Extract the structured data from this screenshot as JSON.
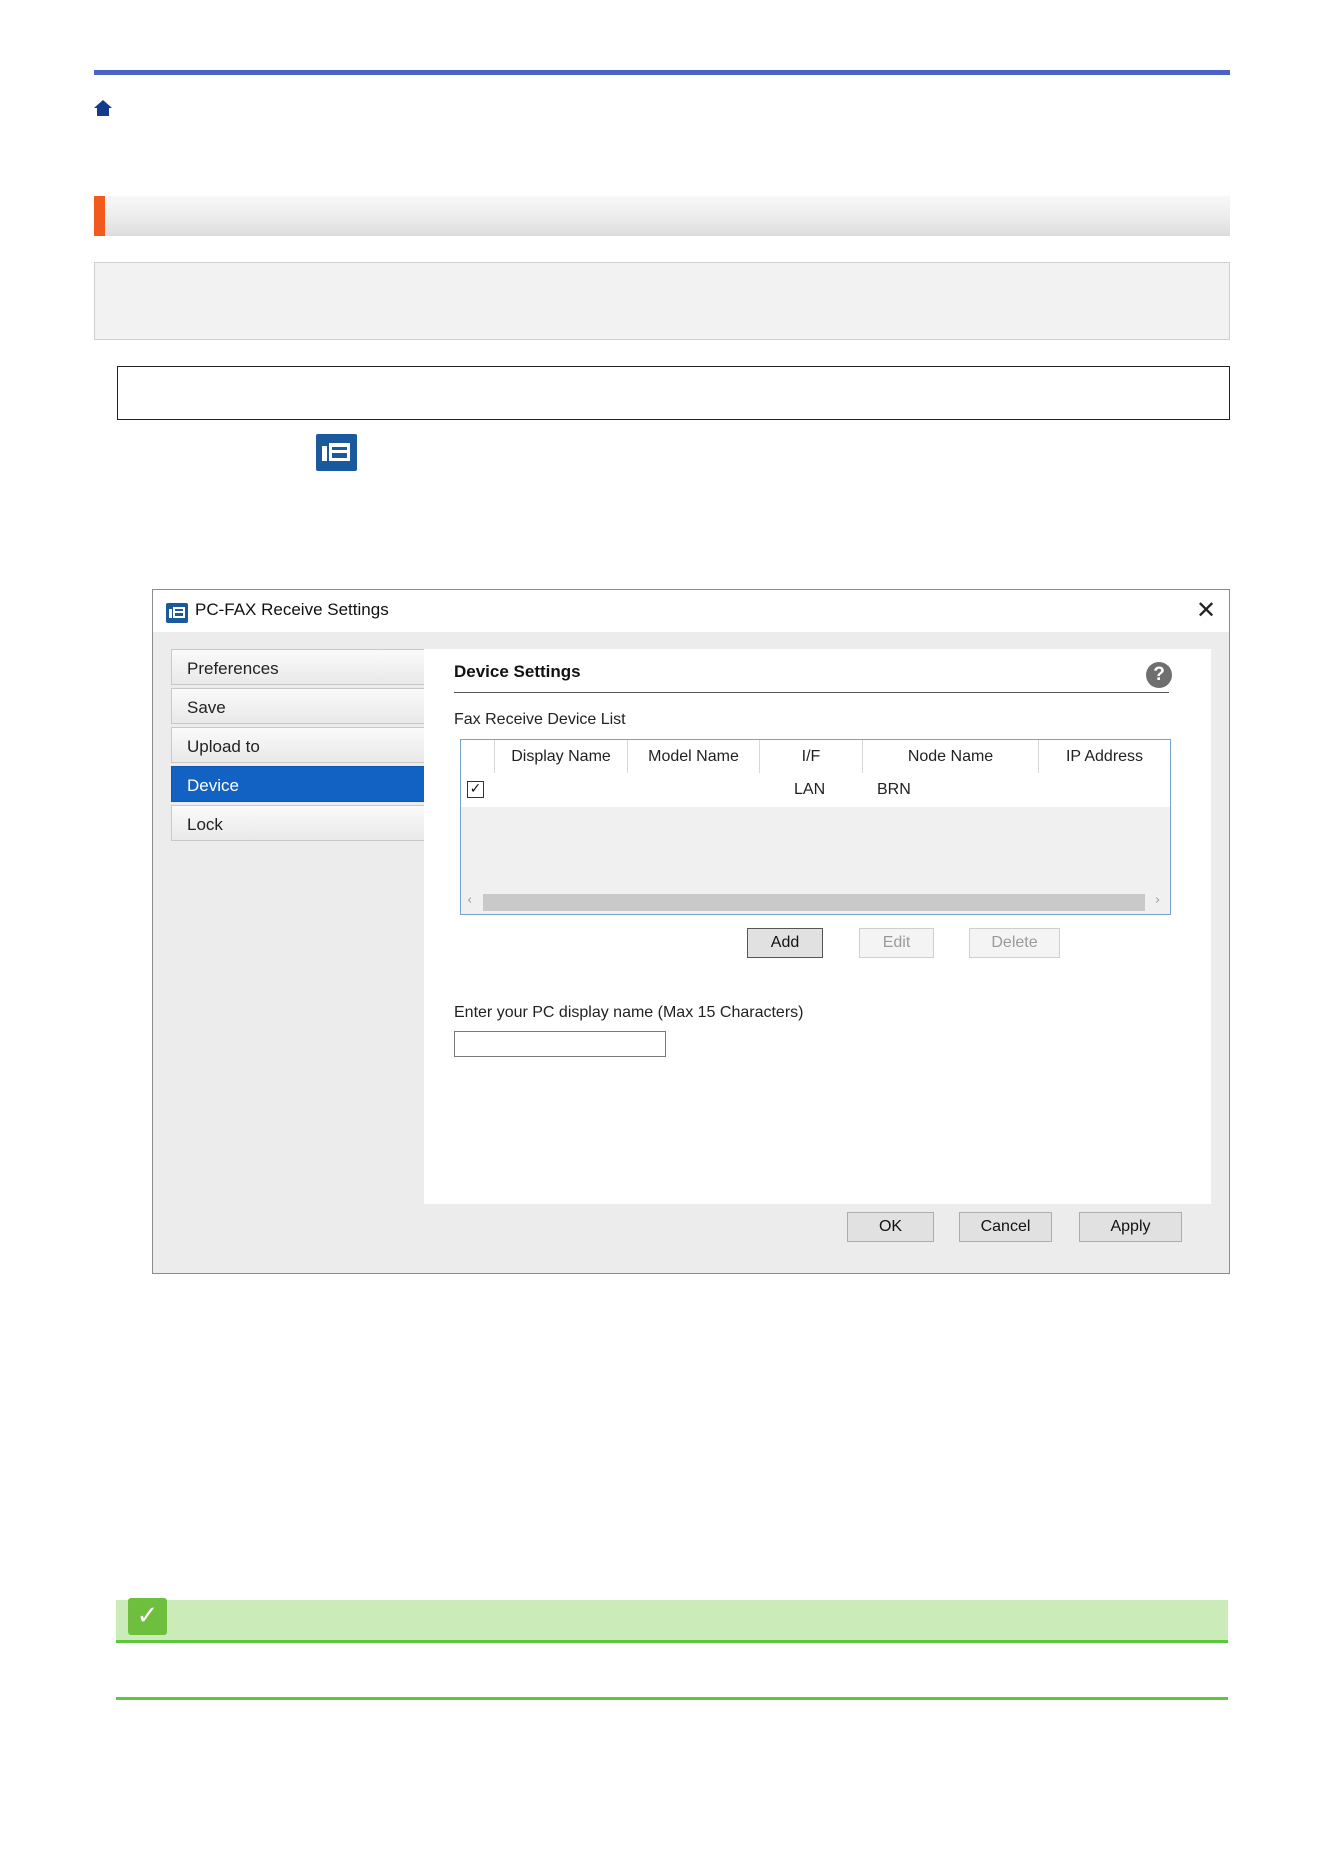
{
  "icons": {
    "home": "home-icon",
    "pcfax": "pc-fax-receive-icon",
    "note": "checkmark-icon"
  },
  "colors": {
    "top_rule": "#4a63c9",
    "section_accent": "#f2591c",
    "dialog_nav_active": "#1162c2",
    "note_bar": "#cbebb8",
    "note_rule": "#5bc83c"
  },
  "dialog": {
    "title": "PC-FAX Receive Settings",
    "close_glyph": "✕",
    "nav_items": [
      {
        "label": "Preferences",
        "active": false
      },
      {
        "label": "Save",
        "active": false
      },
      {
        "label": "Upload to",
        "active": false
      },
      {
        "label": "Device",
        "active": true
      },
      {
        "label": "Lock",
        "active": false
      }
    ],
    "panel": {
      "heading": "Device Settings",
      "help_glyph": "?",
      "list_caption": "Fax Receive Device List",
      "columns": [
        "Display Name",
        "Model Name",
        "I/F",
        "Node Name",
        "IP Address"
      ],
      "rows": [
        {
          "checked": true,
          "display_name": "",
          "model_name": "",
          "interface": "LAN",
          "node_name": "BRN",
          "ip_address": ""
        }
      ],
      "buttons": {
        "add": "Add",
        "edit": "Edit",
        "delete": "Delete"
      },
      "pc_name_label": "Enter your PC display name (Max 15 Characters)",
      "pc_name_value": ""
    },
    "footer_buttons": {
      "ok": "OK",
      "cancel": "Cancel",
      "apply": "Apply"
    }
  }
}
